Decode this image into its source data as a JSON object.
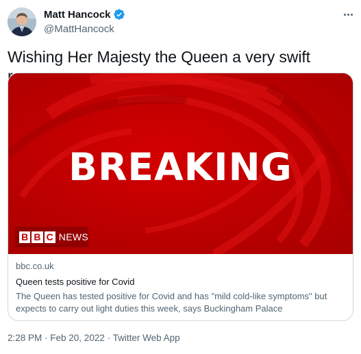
{
  "author": {
    "display_name": "Matt Hancock",
    "handle": "@MattHancock",
    "verified": true
  },
  "icons": {
    "verified": "verified-badge-icon",
    "more": "more-options-icon"
  },
  "tweet": {
    "text": "Wishing Her Majesty the Queen a very swift recovery"
  },
  "card": {
    "image_text": "BREAKING",
    "logo_letters": [
      "B",
      "B",
      "C"
    ],
    "logo_word": "NEWS",
    "domain": "bbc.co.uk",
    "title": "Queen tests positive for Covid",
    "description": "The Queen has tested positive for Covid and has \"mild cold-like symptoms\" but expects to carry out light duties this week, says Buckingham Palace"
  },
  "meta": {
    "time": "2:28 PM",
    "separator": " · ",
    "date": "Feb 20, 2022",
    "source": "Twitter Web App"
  },
  "colors": {
    "brand_red": "#c00000",
    "verified_blue": "#1d9bf0",
    "secondary_text": "#536471",
    "primary_text": "#0f1419",
    "border": "#cfd9de"
  }
}
